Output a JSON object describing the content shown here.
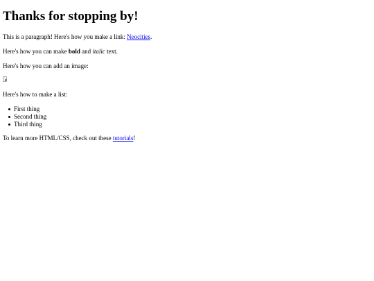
{
  "heading": "Thanks for stopping by!",
  "paragraph1": {
    "before": "This is a paragraph! Here's how you make a link: ",
    "link": "Neocities",
    "after": "."
  },
  "paragraph2": {
    "before": "Here's how you can make ",
    "bold": "bold",
    "middle": " and ",
    "italic": "italic",
    "after": " text."
  },
  "paragraph3": "Here's how you can add an image:",
  "image": {
    "icon": "broken-image-icon"
  },
  "paragraph4": "Here's how to make a list:",
  "list": [
    "First thing",
    "Second thing",
    "Third thing"
  ],
  "paragraph5": {
    "before": "To learn more HTML/CSS, check out these ",
    "link": "tutorials",
    "after": "!"
  },
  "colors": {
    "link": "#0000ee",
    "text": "#000000",
    "background": "#ffffff"
  }
}
